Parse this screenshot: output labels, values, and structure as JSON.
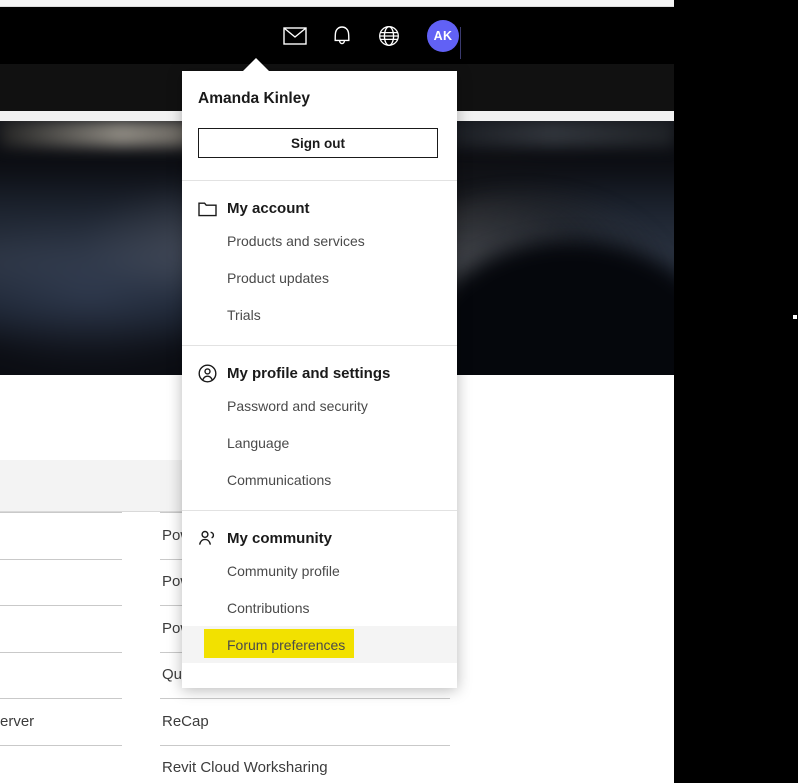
{
  "navbar": {
    "icons": [
      {
        "name": "mail-icon",
        "label": "Messages"
      },
      {
        "name": "bell-icon",
        "label": "Notifications"
      },
      {
        "name": "globe-icon",
        "label": "Region and language"
      }
    ],
    "avatar_initials": "AK",
    "avatar_color": "#6161f5"
  },
  "popup": {
    "user_name": "Amanda Kinley",
    "sign_out_label": "Sign out",
    "sections": [
      {
        "id": "my-account",
        "icon": "folder-icon",
        "title": "My account",
        "links": [
          {
            "label": "Products and services",
            "state": "normal"
          },
          {
            "label": "Product updates",
            "state": "normal"
          },
          {
            "label": "Trials",
            "state": "normal"
          }
        ]
      },
      {
        "id": "my-profile-and-settings",
        "icon": "user-circle-icon",
        "title": "My profile and settings",
        "links": [
          {
            "label": "Password and security",
            "state": "normal"
          },
          {
            "label": "Language",
            "state": "normal"
          },
          {
            "label": "Communications",
            "state": "normal"
          }
        ]
      },
      {
        "id": "my-community",
        "icon": "people-icon",
        "title": "My community",
        "links": [
          {
            "label": "Community profile",
            "state": "normal"
          },
          {
            "label": "Contributions",
            "state": "normal"
          },
          {
            "label": "Forum preferences",
            "state": "highlighted"
          }
        ]
      }
    ],
    "highlight_color": "#f2e100",
    "hover_color": "#f4f4f4"
  },
  "panel": {
    "overflow_label": "...",
    "edit_icon": "pencil-icon"
  },
  "table": {
    "rows": [
      {
        "left": "",
        "right": "Pow"
      },
      {
        "left": "",
        "right": "Pow"
      },
      {
        "left": "",
        "right": "Pow"
      },
      {
        "left": "",
        "right": "Qu"
      },
      {
        "left": "erver",
        "right": "ReCap"
      },
      {
        "left": "",
        "right": "Revit Cloud Worksharing"
      }
    ]
  }
}
